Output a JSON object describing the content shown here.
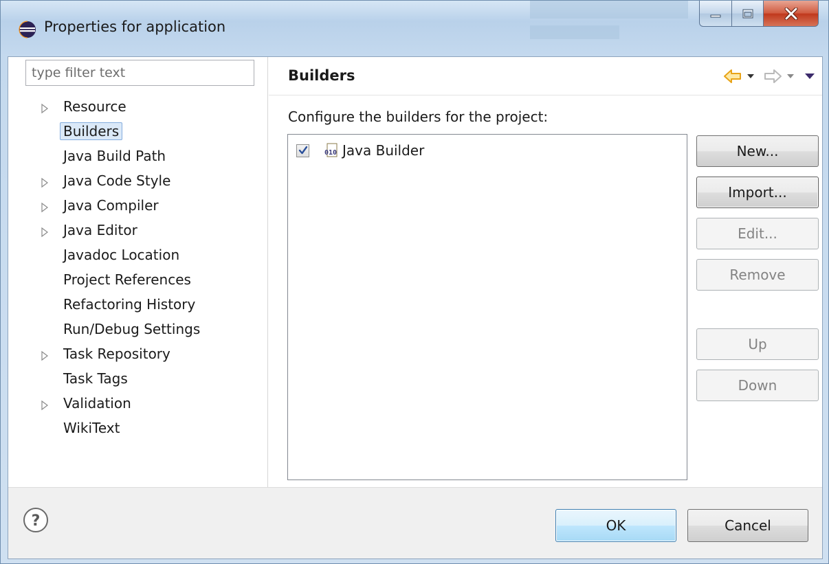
{
  "window": {
    "title": "Properties for application",
    "controls": [
      "minimize-icon",
      "maximize-icon",
      "close-icon"
    ]
  },
  "sidebar": {
    "filter_placeholder": "type filter text",
    "items": [
      {
        "label": "Resource",
        "expandable": true,
        "selected": false
      },
      {
        "label": "Builders",
        "expandable": false,
        "selected": true
      },
      {
        "label": "Java Build Path",
        "expandable": false,
        "selected": false
      },
      {
        "label": "Java Code Style",
        "expandable": true,
        "selected": false
      },
      {
        "label": "Java Compiler",
        "expandable": true,
        "selected": false
      },
      {
        "label": "Java Editor",
        "expandable": true,
        "selected": false
      },
      {
        "label": "Javadoc Location",
        "expandable": false,
        "selected": false
      },
      {
        "label": "Project References",
        "expandable": false,
        "selected": false
      },
      {
        "label": "Refactoring History",
        "expandable": false,
        "selected": false
      },
      {
        "label": "Run/Debug Settings",
        "expandable": false,
        "selected": false
      },
      {
        "label": "Task Repository",
        "expandable": true,
        "selected": false
      },
      {
        "label": "Task Tags",
        "expandable": false,
        "selected": false
      },
      {
        "label": "Validation",
        "expandable": true,
        "selected": false
      },
      {
        "label": "WikiText",
        "expandable": false,
        "selected": false
      }
    ]
  },
  "page": {
    "title": "Builders",
    "description": "Configure the builders for the project:",
    "builders": [
      {
        "label": "Java Builder",
        "checked": true,
        "icon": "binary-010-icon"
      }
    ],
    "buttons": {
      "new": "New...",
      "import": "Import...",
      "edit": "Edit...",
      "remove": "Remove",
      "up": "Up",
      "down": "Down"
    },
    "nav_icons": [
      "back-arrow-icon",
      "back-dropdown-icon",
      "forward-arrow-icon",
      "forward-dropdown-icon",
      "view-menu-icon"
    ]
  },
  "footer": {
    "help_icon": "help-icon",
    "ok_label": "OK",
    "cancel_label": "Cancel"
  },
  "colors": {
    "title_bar": "#c4d9ee",
    "selection": "#dbe9f8",
    "selection_border": "#84acdd",
    "ok_button": "#bee6fd",
    "back_arrow": "#e8a317",
    "close_button": "#c0381c"
  }
}
